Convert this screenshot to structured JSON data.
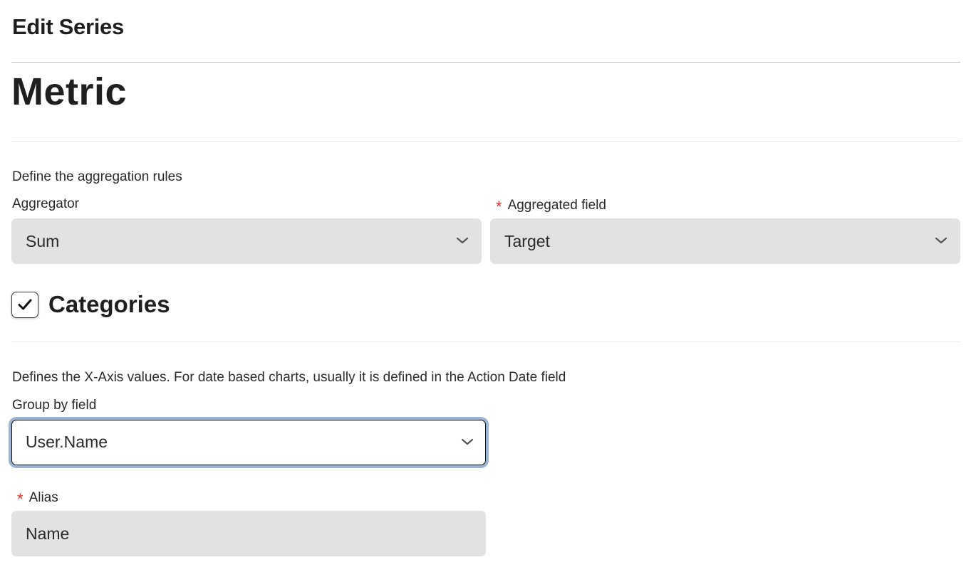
{
  "header": {
    "title": "Edit Series"
  },
  "metric": {
    "title": "Metric",
    "description": "Define the aggregation rules",
    "aggregator": {
      "label": "Aggregator",
      "value": "Sum",
      "icon": "chevron-down-icon"
    },
    "aggregated_field": {
      "required_mark": "*",
      "label": "Aggregated field",
      "value": "Target",
      "icon": "chevron-down-icon"
    }
  },
  "categories": {
    "checked": true,
    "title": "Categories",
    "description": "Defines the X-Axis values. For date based charts, usually it is defined in the Action Date field",
    "group_by": {
      "label": "Group by field",
      "value": "User.Name",
      "icon": "chevron-down-icon"
    },
    "alias": {
      "required_mark": "*",
      "label": "Alias",
      "value": "Name"
    }
  },
  "colors": {
    "required": "#e0322d",
    "field_bg": "#e2e2e2",
    "focus_ring": "#9cb3d4"
  }
}
